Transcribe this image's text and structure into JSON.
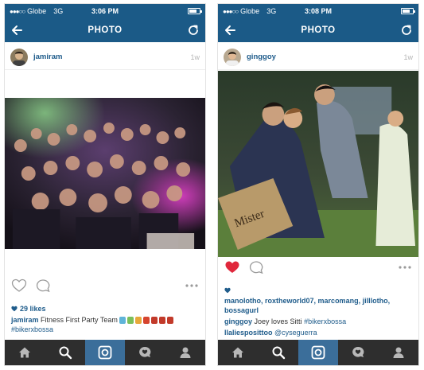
{
  "left": {
    "status": {
      "carrier": "Globe",
      "network": "3G",
      "time": "3:06 PM",
      "battery_level": 0.6
    },
    "nav": {
      "title": "PHOTO"
    },
    "post": {
      "username": "jamiram",
      "age": "1w",
      "likes": "29 likes",
      "caption_user": "jamiram",
      "caption_text": "Fitness First Party Team",
      "hashtag": "#bikerxbossa"
    }
  },
  "right": {
    "status": {
      "carrier": "Globe",
      "network": "3G",
      "time": "3:08 PM",
      "battery_level": 0.6
    },
    "nav": {
      "title": "PHOTO"
    },
    "post": {
      "username": "ginggoy",
      "age": "1w",
      "liked": true,
      "likers": [
        "manolotho",
        "roxtheworld07",
        "marcomang",
        "jilllotho",
        "bossagurl"
      ],
      "photo_sign": "Mister",
      "comments": [
        {
          "user": "ginggoy",
          "text": "Joey loves Sitti",
          "tag": "#bikerxbossa"
        },
        {
          "user": "llaliespositt",
          "text": "oo",
          "mention": "@cyseguerra"
        }
      ]
    }
  },
  "colors": {
    "bar": "#1b5a87",
    "link": "#1f5c8b",
    "tab_bg": "#2e2e2e",
    "tab_active": "#3b6e9a",
    "liked_heart": "#e0283c"
  }
}
